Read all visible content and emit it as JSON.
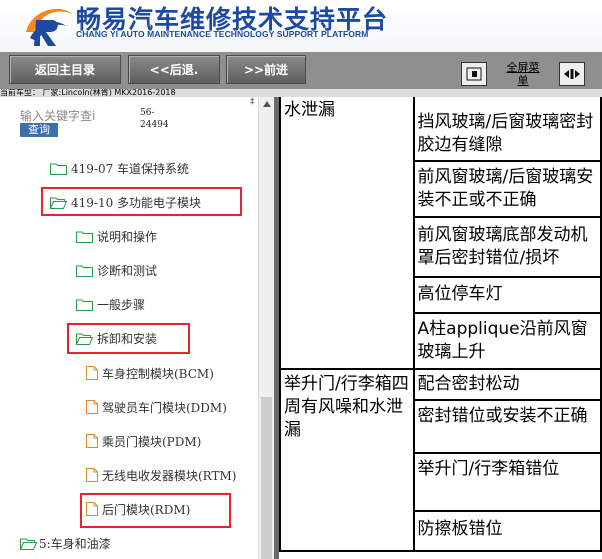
{
  "header": {
    "title_cn": "畅易汽车维修技术支持平台",
    "title_en": "CHANG YI AUTO MAINTENANCE TECHNOLOGY SUPPORT PLATFORM",
    "brand_color": "#1b4aa0",
    "logo_accent": "#f08a1c"
  },
  "toolbar": {
    "home_label": "返回主目录",
    "back_label": "<<后退.",
    "forward_label": ">>前进",
    "fullscreen_label": "全屏菜单"
  },
  "car_info": "当前车型： 厂家:Lincoln(林肯) MKX2016-2018",
  "search": {
    "placeholder": "输入关键字查i",
    "button_label": "查询",
    "doc_number": "56-24494"
  },
  "tree": {
    "items": [
      {
        "label": "419-07 车道保持系统",
        "icon": "folder-icon"
      },
      {
        "label": "419-10 多功能电子模块",
        "icon": "folder-open-icon"
      },
      {
        "label": "说明和操作",
        "icon": "folder-icon"
      },
      {
        "label": "诊断和测试",
        "icon": "folder-icon"
      },
      {
        "label": "一般步骤",
        "icon": "folder-icon"
      },
      {
        "label": "拆卸和安装",
        "icon": "folder-open-icon"
      },
      {
        "label": "车身控制模块(BCM)",
        "icon": "document-icon"
      },
      {
        "label": "驾驶员车门模块(DDM)",
        "icon": "document-icon"
      },
      {
        "label": "乘员门模块(PDM)",
        "icon": "document-icon"
      },
      {
        "label": "无线电收发器模块(RTM)",
        "icon": "document-icon"
      },
      {
        "label": "后门模块(RDM)",
        "icon": "document-icon"
      },
      {
        "label": "5:车身和油漆",
        "icon": "folder-icon"
      }
    ],
    "highlight_color": "#e8222f"
  },
  "table": {
    "rows": [
      {
        "location": "水泄漏",
        "cause": "挡风玻璃/后窗玻璃密封胶边有缝隙"
      },
      {
        "location": "",
        "cause": "前风窗玻璃/后窗玻璃安装不正或不正确"
      },
      {
        "location": "",
        "cause": "前风窗玻璃底部发动机罩后密封错位/损坏"
      },
      {
        "location": "",
        "cause": "高位停车灯"
      },
      {
        "location": "",
        "cause": "A柱applique沿前风窗玻璃上升"
      },
      {
        "location": "举升门/行李箱四周有风噪和水泄漏",
        "cause": "配合密封松动"
      },
      {
        "location": "",
        "cause": "密封错位或安装不正确"
      },
      {
        "location": "",
        "cause": "举升门/行李箱错位"
      },
      {
        "location": "",
        "cause": "防擦板错位"
      }
    ]
  }
}
